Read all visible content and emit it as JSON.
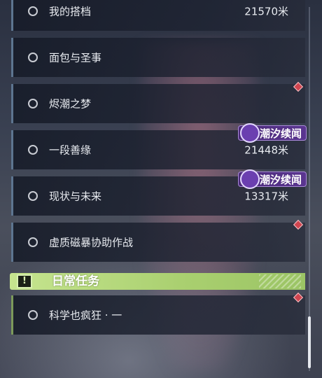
{
  "quests": [
    {
      "name": "我的搭档",
      "distance": "21570米",
      "badge": "",
      "marker": false
    },
    {
      "name": "面包与圣事",
      "distance": "",
      "badge": "",
      "marker": false
    },
    {
      "name": "烬潮之梦",
      "distance": "",
      "badge": "",
      "marker": true
    },
    {
      "name": "一段善缘",
      "distance": "21448米",
      "badge": "潮汐续闻",
      "marker": false
    },
    {
      "name": "现状与未来",
      "distance": "13317米",
      "badge": "潮汐续闻",
      "marker": false
    },
    {
      "name": "虚质磁暴协助作战",
      "distance": "",
      "badge": "",
      "marker": true
    }
  ],
  "daily_section": {
    "title": "日常任务",
    "icon": "exclamation-icon",
    "quests": [
      {
        "name": "科学也疯狂 · 一",
        "distance": "",
        "marker": true
      }
    ]
  },
  "colors": {
    "daily_accent": "#b5d97a",
    "badge_purple": "#5a3590",
    "marker_red": "#d0454f"
  }
}
